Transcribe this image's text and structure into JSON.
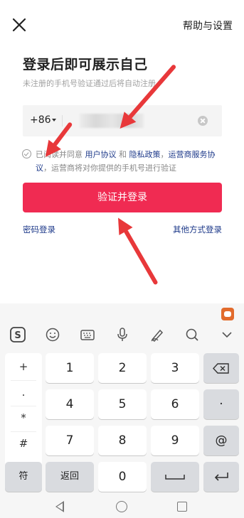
{
  "header": {
    "close_icon": "close-icon",
    "help_label": "帮助与设置"
  },
  "main": {
    "title": "登录后即可展示自己",
    "subtitle": "未注册的手机号验证通过后将自动注册"
  },
  "phone": {
    "country_code": "+86",
    "number_masked": true
  },
  "agreement": {
    "prefix": "已阅读并同意 ",
    "user_agreement": "用户协议",
    "and": " 和 ",
    "privacy": "隐私政策",
    "sep": "，",
    "operator": "运营商服务协议",
    "suffix": "，运营商将对你提供的手机号进行验证"
  },
  "actions": {
    "login_button": "验证并登录",
    "password_login": "密码登录",
    "other_login": "其他方式登录"
  },
  "keyboard": {
    "left_column": [
      "+",
      ".",
      "*",
      "#"
    ],
    "keys": [
      "1",
      "2",
      "3",
      "4",
      "5",
      "6",
      "7",
      "8",
      "9",
      "0"
    ],
    "symbol_key": "符",
    "back_key": "返回",
    "dot_key": "·",
    "at_key": "@",
    "toolbar_icons": [
      "sogou-logo-icon",
      "emoji-icon",
      "keyboard-icon",
      "microphone-icon",
      "handwriting-icon",
      "search-icon",
      "chevron-down-icon"
    ]
  },
  "colors": {
    "accent": "#f02b52",
    "link": "#1e3a8a",
    "arrow": "#e8383a"
  }
}
